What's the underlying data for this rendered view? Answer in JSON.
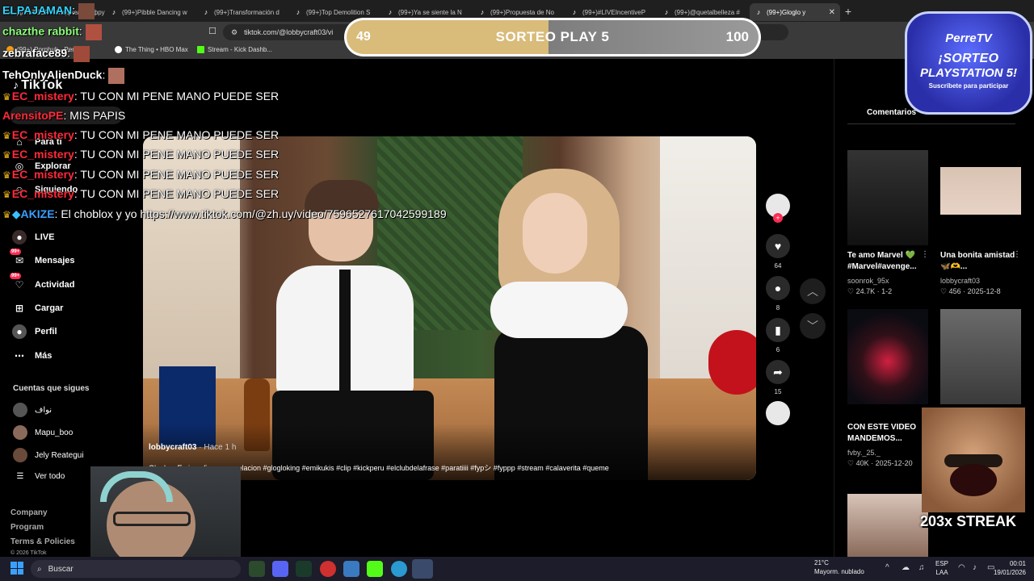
{
  "browser": {
    "tabs": [
      {
        "label": "ДЛЯ ТЕБЯ - пледжелки #фрукт",
        "active": false
      },
      {
        "label": "(99+)Pibble Dancing w",
        "active": false
      },
      {
        "label": "(99+)Transformación d",
        "active": false
      },
      {
        "label": "(99+)Top Demolition S",
        "active": false
      },
      {
        "label": "(99+)Ya se siente la N",
        "active": false
      },
      {
        "label": "(99+)Propuesta de No",
        "active": false
      },
      {
        "label": "(99+)#LIVEIncentiveP",
        "active": false
      },
      {
        "label": "(99+)@quetalbelleza #",
        "active": false
      },
      {
        "label": "(99+)Gloglo y",
        "active": true
      }
    ],
    "url": "tiktok.com/@lobbycraft03/vi",
    "bookmarks": [
      {
        "label": "(99+) Pornhub - Perde..."
      },
      {
        "label": "The Thing • HBO Max"
      },
      {
        "label": "Stream - Kick Dashb..."
      }
    ]
  },
  "chat": [
    {
      "user": "ELPAJAMAN",
      "text": "",
      "color": "#2fd4ff",
      "crown": false
    },
    {
      "user": "chazthe rabbit",
      "text": "",
      "color": "#8cff7a",
      "crown": false
    },
    {
      "user": "zebraface89",
      "text": "",
      "color": "#ffffff",
      "crown": false
    },
    {
      "user": "TehOnlyAlienDuck",
      "text": "",
      "color": "#ffffff",
      "crown": false
    },
    {
      "user": "EC_mistery",
      "text": ": TU CON MI PENE MANO PUEDE SER",
      "color": "#ff2a3a",
      "crown": true
    },
    {
      "user": "ArensitoPE",
      "text": ": MIS PAPIS",
      "color": "#ff2a3a",
      "crown": false
    },
    {
      "user": "EC_mistery",
      "text": ": TU CON MI PENE MANO PUEDE SER",
      "color": "#ff2a3a",
      "crown": true
    },
    {
      "user": "EC_mistery",
      "text": ": TU CON MI PENE MANO PUEDE SER",
      "color": "#ff2a3a",
      "crown": true
    },
    {
      "user": "EC_mistery",
      "text": ": TU CON MI PENE MANO PUEDE SER",
      "color": "#ff2a3a",
      "crown": true
    },
    {
      "user": "EC_mistery",
      "text": ": TU CON MI PENE MANO PUEDE SER",
      "color": "#ff2a3a",
      "crown": true
    },
    {
      "user": "AKIZE",
      "text": ": El choblox y yo https://www.tiktok.com/@zh.uy/video/7596527617042599189",
      "color": "#3aa0ff",
      "crown": true
    }
  ],
  "sidebar": {
    "logo": "TikTok",
    "nav": [
      {
        "label": "Para ti",
        "icon": "home-icon"
      },
      {
        "label": "Explorar",
        "icon": "compass-icon"
      },
      {
        "label": "Siguiendo",
        "icon": "following-icon"
      },
      {
        "label": "LIVE",
        "icon": "live-icon"
      },
      {
        "label": "Mensajes",
        "icon": "messages-icon",
        "badge": "99+"
      },
      {
        "label": "Actividad",
        "icon": "activity-icon",
        "badge": "99+"
      },
      {
        "label": "Cargar",
        "icon": "upload-icon"
      },
      {
        "label": "Perfil",
        "icon": "profile-icon"
      },
      {
        "label": "Más",
        "icon": "more-icon"
      }
    ],
    "following_title": "Cuentas que sigues",
    "following": [
      {
        "name": "نواف"
      },
      {
        "name": "Mapu_boo"
      },
      {
        "name": "Jely Reategui"
      }
    ],
    "see_all": "Ver todo",
    "footer": [
      "Company",
      "Program",
      "Terms & Policies",
      "© 2026 TikTok"
    ]
  },
  "video": {
    "author": "lobbycraft03",
    "ago": " · Hace 1 h",
    "description": "Gloglo y Emi confirman su relacion #glogloking #emikukis #clip #kickperu #elclubdelafrase #paratiiii #fypシ #fyppp #stream #calaverita #queme"
  },
  "actions": {
    "likes": "64",
    "comments": "8",
    "saves": "6",
    "shares": "15"
  },
  "right_panel": {
    "tab": "Comentarios",
    "videos": [
      {
        "title": "Te amo Marvel 💚 #Marvel#avenge...",
        "user": "soonrok_95x",
        "meta": "♡ 24.7K · 1-2"
      },
      {
        "title": "Una bonita amistad 🦋🫶...",
        "user": "lobbycraft03",
        "meta": "♡ 456 · 2025-12-8"
      },
      {
        "title": "CON ESTE VIDEO MANDEMOS...",
        "user": "fvby._25._",
        "meta": "♡ 40K · 2025-12-20"
      },
      {
        "title": "",
        "user": "",
        "meta": ""
      }
    ]
  },
  "overlay": {
    "raffle_left": "49",
    "raffle_title": "SORTEO PLAY 5",
    "raffle_right": "100",
    "raffle_progress": 0.49,
    "promo_brand": "PerreTV",
    "promo_line1": "¡SORTEO",
    "promo_line2": "PLAYSTATION 5!",
    "promo_sub": "Suscríbete para participar",
    "streak": "203x STREAK"
  },
  "taskbar": {
    "search": "Buscar",
    "weather_temp": "21°C",
    "weather_desc": "Mayorm. nublado",
    "lang": "ESP",
    "lang2": "LAA",
    "time": "00:01",
    "date": "19/01/2026"
  }
}
